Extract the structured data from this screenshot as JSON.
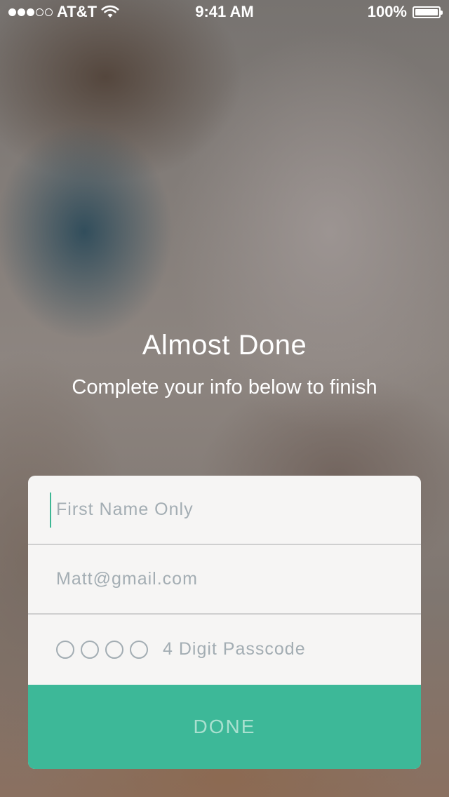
{
  "status_bar": {
    "carrier": "AT&T",
    "time": "9:41 AM",
    "battery": "100%",
    "signal_bars_filled": 3,
    "signal_bars_total": 5,
    "wifi_icon": "wifi-icon",
    "battery_level": 1.0
  },
  "header": {
    "title": "Almost Done",
    "subtitle": "Complete your info below to finish"
  },
  "form": {
    "first_name": {
      "placeholder": "First Name Only",
      "value": ""
    },
    "email": {
      "placeholder": "Matt@gmail.com",
      "value": ""
    },
    "passcode": {
      "label": "4 Digit Passcode",
      "digits_entered": 0,
      "digits_total": 4
    },
    "done_label": "DONE"
  },
  "colors": {
    "accent": "#3db898",
    "placeholder": "#a3adb3",
    "card_background": "#f6f5f4"
  }
}
